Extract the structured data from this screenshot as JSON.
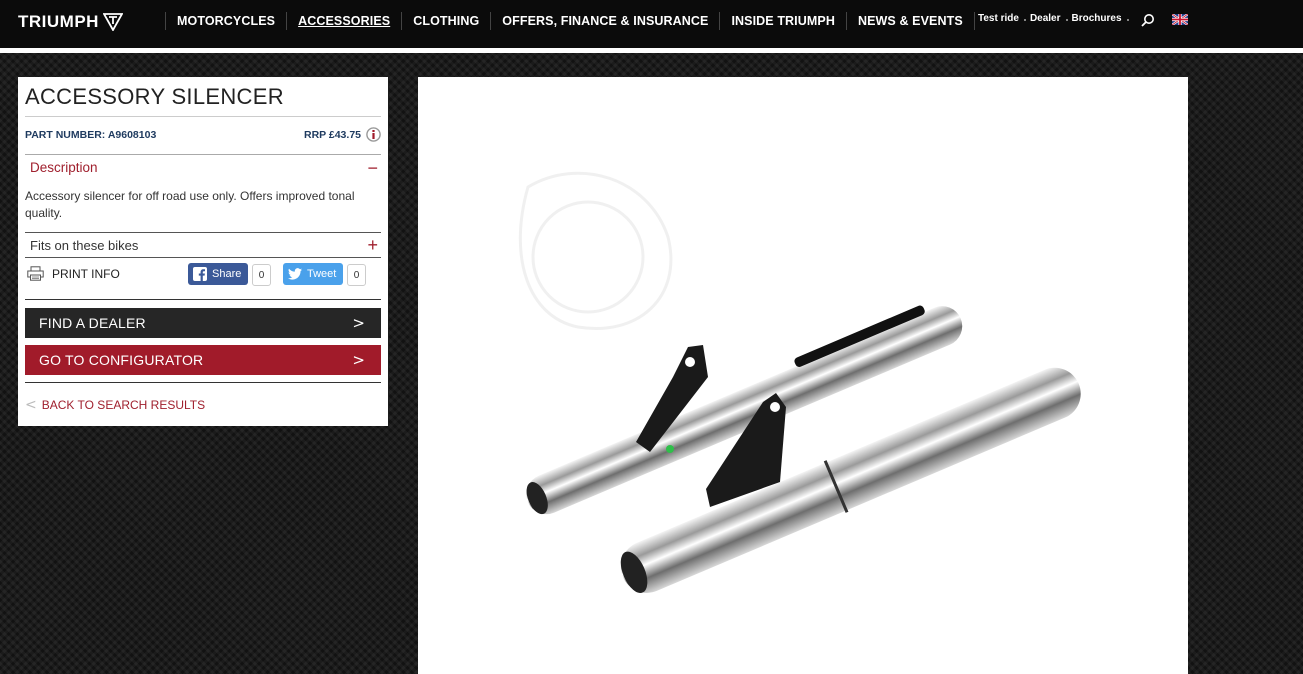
{
  "header": {
    "logo_text": "TRIUMPH",
    "nav": [
      {
        "label": "MOTORCYCLES",
        "active": false
      },
      {
        "label": "ACCESSORIES",
        "active": true
      },
      {
        "label": "CLOTHING",
        "active": false
      },
      {
        "label": "OFFERS, FINANCE & INSURANCE",
        "active": false
      },
      {
        "label": "INSIDE TRIUMPH",
        "active": false
      },
      {
        "label": "NEWS & EVENTS",
        "active": false
      }
    ],
    "utility": [
      "Test ride",
      "Dealer",
      "Brochures"
    ],
    "search_icon": "search-icon",
    "flag_icon": "uk-flag-icon"
  },
  "product": {
    "title": "ACCESSORY SILENCER",
    "part_number": "PART NUMBER: A9608103",
    "rrp": "RRP £43.75",
    "description_label": "Description",
    "description_toggle": "−",
    "description_text": "Accessory silencer for off road use only. Offers improved tonal quality.",
    "fits_label": "Fits on these bikes",
    "fits_toggle": "+",
    "print_label": "PRINT INFO",
    "facebook": {
      "label": "Share",
      "count": "0"
    },
    "twitter": {
      "label": "Tweet",
      "count": "0"
    },
    "find_dealer": "FIND A DEALER",
    "configurator": "GO TO CONFIGURATOR",
    "back": "BACK TO SEARCH RESULTS"
  },
  "colors": {
    "accent_red": "#a11b2a",
    "dark_button": "#262626",
    "facebook": "#3b5998",
    "twitter": "#4aa1eb"
  }
}
